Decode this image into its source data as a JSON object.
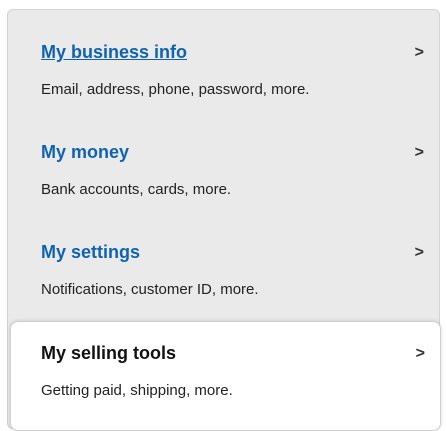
{
  "menu": {
    "items": [
      {
        "title": "My business info",
        "description": "Email, address, phone, password, more.",
        "chevron": ">"
      },
      {
        "title": "My money",
        "description": "Bank accounts, cards, more.",
        "chevron": ">"
      },
      {
        "title": "My settings",
        "description": "Notifications, customer ID, more.",
        "chevron": ">"
      },
      {
        "title": "My selling tools",
        "description": "Getting paid, shipping, more.",
        "chevron": ">"
      }
    ],
    "selected_index": 3
  },
  "colors": {
    "link": "#0f63b3",
    "panel_background": "#eaeaea",
    "selected_background": "#ffffff"
  }
}
